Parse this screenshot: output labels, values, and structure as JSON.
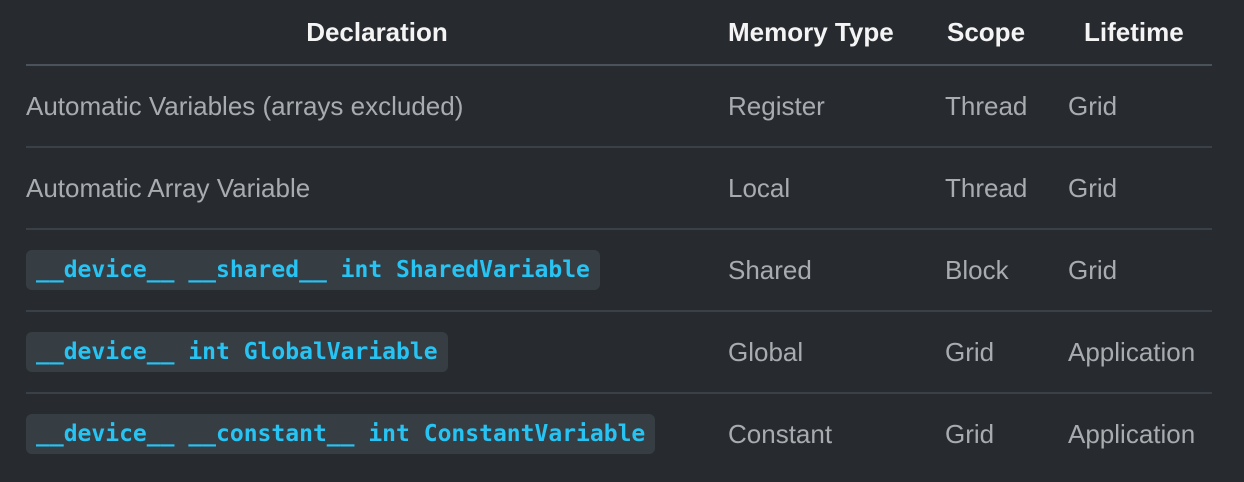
{
  "headers": {
    "declaration": "Declaration",
    "memory_type": "Memory Type",
    "scope": "Scope",
    "lifetime": "Lifetime"
  },
  "rows": [
    {
      "declaration": "Automatic Variables (arrays excluded)",
      "is_code": false,
      "memory_type": "Register",
      "scope": "Thread",
      "lifetime": "Grid"
    },
    {
      "declaration": "Automatic Array Variable",
      "is_code": false,
      "memory_type": "Local",
      "scope": "Thread",
      "lifetime": "Grid"
    },
    {
      "declaration": "__device__ __shared__ int SharedVariable",
      "is_code": true,
      "memory_type": "Shared",
      "scope": "Block",
      "lifetime": "Grid"
    },
    {
      "declaration": "__device__ int GlobalVariable",
      "is_code": true,
      "memory_type": "Global",
      "scope": "Grid",
      "lifetime": "Application"
    },
    {
      "declaration": "__device__ __constant__ int ConstantVariable",
      "is_code": true,
      "memory_type": "Constant",
      "scope": "Grid",
      "lifetime": "Application"
    }
  ],
  "colors": {
    "background": "#272b30",
    "header_text": "#f4f4f4",
    "body_text": "#a8acaf",
    "code_text": "#27c3f3",
    "code_background": "#363e44"
  }
}
